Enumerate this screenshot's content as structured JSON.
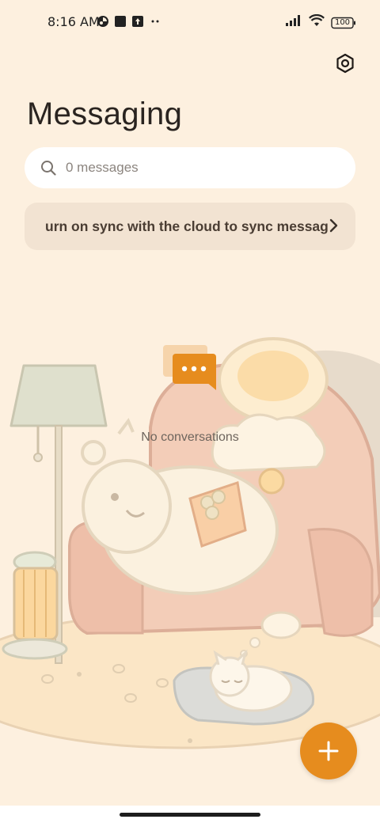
{
  "status_bar": {
    "time": "8:16 AM",
    "battery": "100"
  },
  "header": {
    "title": "Messaging",
    "settings_icon": "settings-gear-icon"
  },
  "search": {
    "placeholder": "0 messages",
    "icon": "search-icon"
  },
  "sync_banner": {
    "text": "urn on sync with the cloud to sync messag"
  },
  "empty_state": {
    "text": "No conversations"
  },
  "fab": {
    "icon": "plus-icon"
  },
  "colors": {
    "background": "#fdf0df",
    "accent": "#e68c1e",
    "search_bg": "#ffffff",
    "banner_bg": "#f2e3d2"
  }
}
